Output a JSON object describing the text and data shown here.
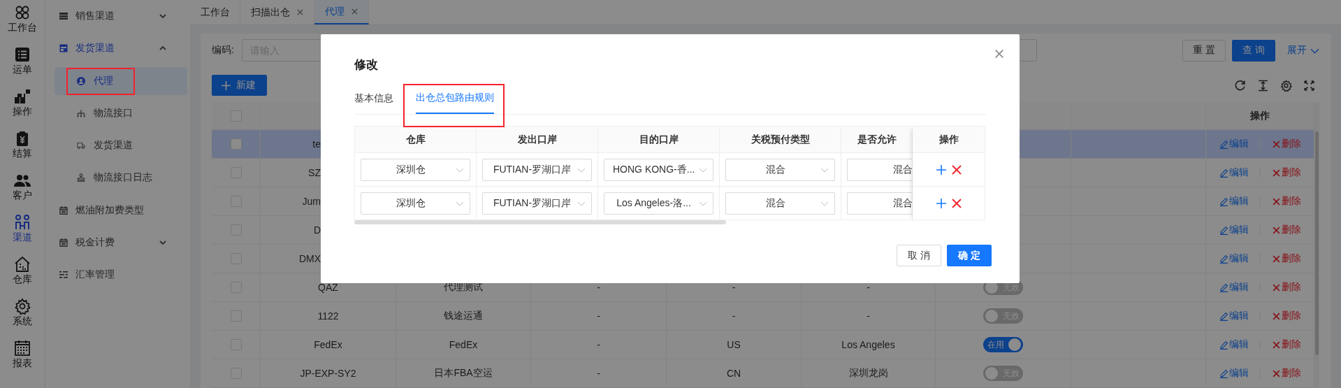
{
  "rail": [
    {
      "label": "工作台",
      "selected": false
    },
    {
      "label": "运单",
      "selected": false
    },
    {
      "label": "操作",
      "selected": false
    },
    {
      "label": "结算",
      "selected": false
    },
    {
      "label": "客户",
      "selected": false
    },
    {
      "label": "渠道",
      "selected": true
    },
    {
      "label": "仓库",
      "selected": false
    },
    {
      "label": "系统",
      "selected": false
    },
    {
      "label": "报表",
      "selected": false
    }
  ],
  "submenu": [
    {
      "label": "销售渠道",
      "expanded": false
    },
    {
      "label": "发货渠道",
      "expanded": true,
      "children": [
        {
          "label": "代理",
          "selected": true,
          "annotated": true
        },
        {
          "label": "物流接口",
          "selected": false,
          "annotated": false
        },
        {
          "label": "发货渠道",
          "selected": false,
          "annotated": false
        },
        {
          "label": "物流接口日志",
          "selected": false,
          "annotated": false
        }
      ]
    },
    {
      "label": "燃油附加费类型",
      "selected": false
    },
    {
      "label": "税金计费",
      "expanded": false
    },
    {
      "label": "汇率管理",
      "selected": false
    }
  ],
  "tabs": [
    {
      "label": "工作台",
      "closable": false,
      "selected": false
    },
    {
      "label": "扫描出仓",
      "closable": true,
      "selected": false
    },
    {
      "label": "代理",
      "closable": true,
      "selected": true
    }
  ],
  "search": {
    "label": "编码:",
    "placeholder": "请输入"
  },
  "buttons": {
    "reset": "重 置",
    "query": "查 询",
    "expand": "展开"
  },
  "new_button": "新建",
  "table": {
    "action_header": "操作",
    "all_checked": false,
    "rows": [
      {
        "selected": true,
        "checked": false,
        "code": "te",
        "edit": "编辑",
        "delete": "删除"
      },
      {
        "selected": false,
        "checked": false,
        "code": "SZ",
        "edit": "编辑",
        "delete": "删除"
      },
      {
        "selected": false,
        "checked": false,
        "code": "Jum",
        "edit": "编辑",
        "delete": "删除"
      },
      {
        "selected": false,
        "checked": false,
        "code": "D",
        "edit": "编辑",
        "delete": "删除"
      },
      {
        "selected": false,
        "checked": false,
        "code": "DMX",
        "edit": "编辑",
        "delete": "删除"
      },
      {
        "selected": false,
        "checked": false,
        "code": "QAZ",
        "cells": [
          "代理测试",
          "-",
          "-",
          "-"
        ],
        "status": {
          "on": false,
          "label": "无效"
        },
        "edit": "编辑",
        "delete": "删除"
      },
      {
        "selected": false,
        "checked": false,
        "code": "1122",
        "cells": [
          "钱途运通",
          "-",
          "-",
          "-"
        ],
        "status": {
          "on": false,
          "label": "无效"
        },
        "edit": "编辑",
        "delete": "删除"
      },
      {
        "selected": false,
        "checked": false,
        "code": "FedEx",
        "cells": [
          "FedEx",
          "-",
          "US",
          "Los Angeles"
        ],
        "status": {
          "on": true,
          "label": "在用"
        },
        "edit": "编辑",
        "delete": "删除"
      },
      {
        "selected": false,
        "checked": false,
        "code": "JP-EXP-SY2",
        "cells": [
          "日本FBA空运",
          "-",
          "CN",
          "深圳龙岗"
        ],
        "status": {
          "on": false,
          "label": "无效"
        },
        "edit": "编辑",
        "delete": "删除"
      }
    ]
  },
  "modal": {
    "title": "修改",
    "tabs": [
      {
        "label": "基本信息",
        "selected": false,
        "annotated": false
      },
      {
        "label": "出仓总包路由规则",
        "selected": true,
        "annotated": true
      }
    ],
    "columns": [
      "仓库",
      "发出口岸",
      "目的口岸",
      "关税预付类型",
      "是否允许"
    ],
    "action_header": "操作",
    "rows": [
      {
        "values": [
          "深圳仓",
          "FUTIAN-罗湖口岸",
          "HONG KONG-香...",
          "混合",
          "混合"
        ]
      },
      {
        "values": [
          "深圳仓",
          "FUTIAN-罗湖口岸",
          "Los Angeles-洛...",
          "混合",
          "混合"
        ]
      }
    ],
    "buttons": [
      {
        "label": "取 消",
        "kind": "default"
      },
      {
        "label": "确 定",
        "kind": "primary"
      }
    ]
  }
}
